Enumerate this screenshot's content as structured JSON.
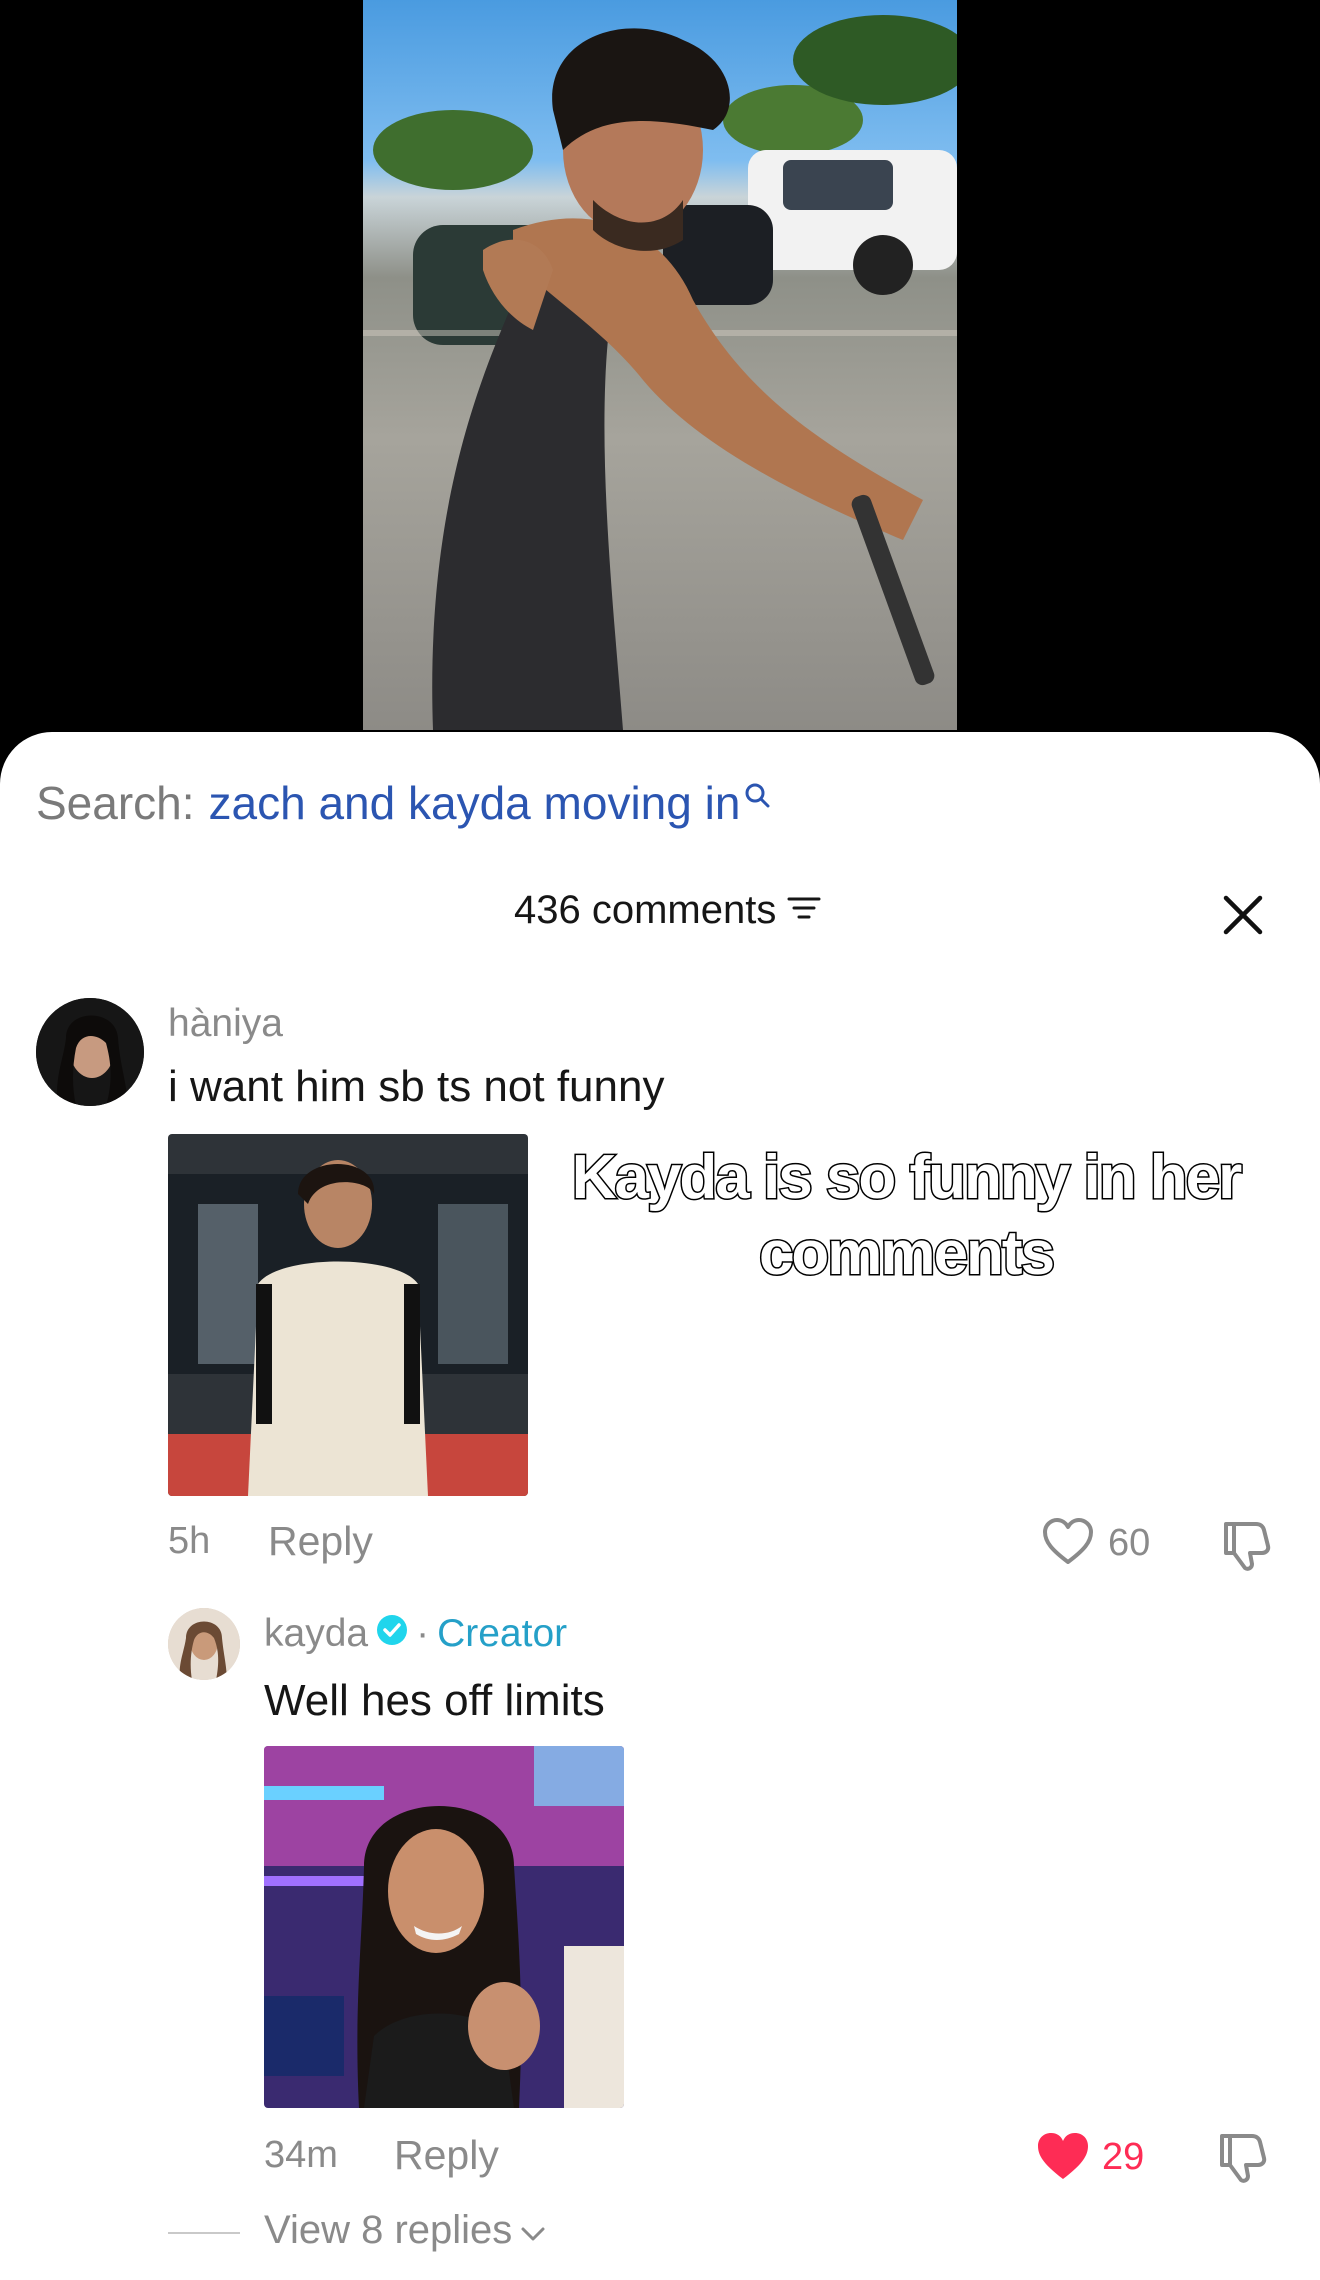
{
  "search": {
    "label": "Search:",
    "query": "zach and kayda moving in"
  },
  "comments_header": {
    "count_label": "436 comments"
  },
  "overlay_caption": "Kayda is so funny in her comments",
  "comment": {
    "username": "hàniya",
    "text": "i want him sb ts not funny",
    "time": "5h",
    "reply_label": "Reply",
    "likes": "60",
    "liked": false
  },
  "reply": {
    "username": "kayda",
    "separator": "·",
    "badge": "Creator",
    "text": "Well hes off limits",
    "time": "34m",
    "reply_label": "Reply",
    "likes": "29",
    "liked": true,
    "like_color": "#fe2c55"
  },
  "view_replies": {
    "label": "View 8 replies"
  },
  "colors": {
    "link_blue": "#2b55b1",
    "creator_teal": "#25a0c8",
    "verified": "#20d5ec"
  },
  "icons": [
    "search-icon",
    "filter-icon",
    "close-icon",
    "heart-icon",
    "dislike-icon",
    "verified-icon",
    "chevron-down-icon"
  ]
}
